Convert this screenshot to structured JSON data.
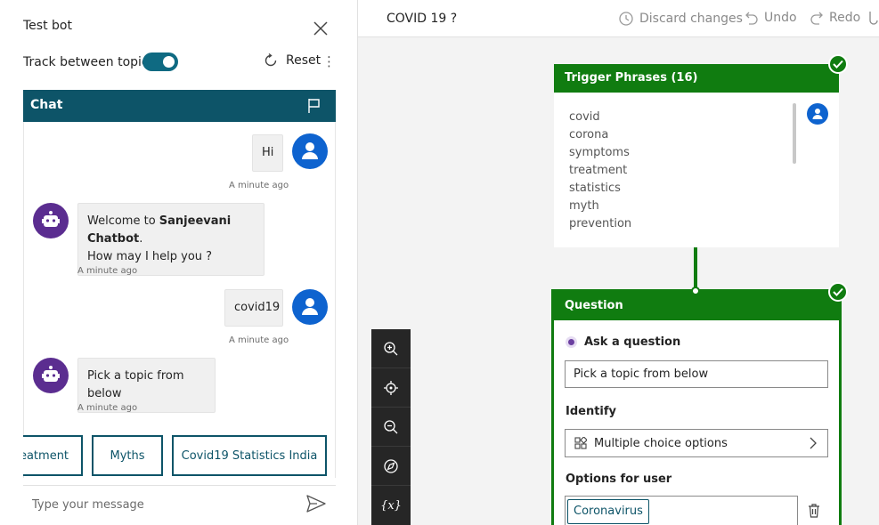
{
  "testbot": {
    "title": "Test bot",
    "track_label": "Track between topics",
    "reset_label": "Reset",
    "more_glyph": "⋮",
    "chat_header": "Chat",
    "messages": {
      "m1_text": "Hi",
      "m1_time": "A minute ago",
      "m2_line1_prefix": "Welcome to ",
      "m2_bot_name": "Sanjeevani Chatbot",
      "m2_line1_suffix": ".",
      "m2_line2": "How may I help you ?",
      "m2_time": "A minute ago",
      "m3_text": "covid19",
      "m3_time": "A minute ago",
      "m4_text": "Pick a topic from below",
      "m4_time": "A minute ago"
    },
    "suggestions": [
      "eatment",
      "Myths",
      "Covid19 Statistics India"
    ],
    "input_placeholder": "Type your message"
  },
  "topbar": {
    "topic_name": "COVID 19 ?",
    "discard_label": "Discard changes",
    "undo_label": "Undo",
    "redo_label": "Redo"
  },
  "zoom_controls": [
    "zoom-in-icon",
    "fit-view-icon",
    "zoom-out-icon",
    "compass-icon",
    "variables-icon"
  ],
  "variables_glyph": "{x}",
  "trigger": {
    "title": "Trigger Phrases (16)",
    "phrases": [
      "covid",
      "corona",
      "symptoms",
      "treatment",
      "statistics",
      "myth",
      "prevention"
    ]
  },
  "question": {
    "title": "Question",
    "ask_label": "Ask a question",
    "question_text": "Pick a topic from below",
    "identify_label": "Identify",
    "identify_value": "Multiple choice options",
    "options_label": "Options for user",
    "first_option": "Coronavirus"
  },
  "colors": {
    "teal": "#0d5468",
    "green": "#107c10",
    "user_avatar": "#0e63cf",
    "bot_avatar": "#5b2d90"
  }
}
